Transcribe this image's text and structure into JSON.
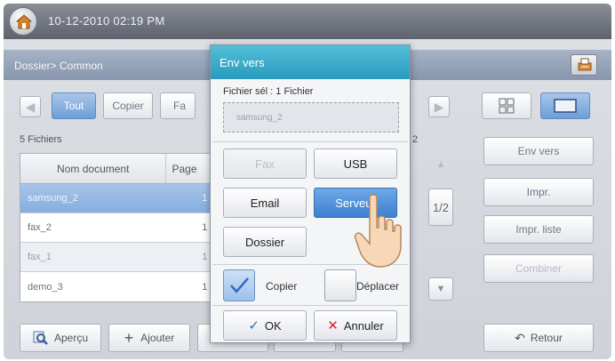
{
  "status_bar": {
    "datetime": "10-12-2010 02:19 PM"
  },
  "breadcrumb": {
    "path": "Dossier> Common"
  },
  "file_tabs": [
    {
      "label": "Tout",
      "state": "selected"
    },
    {
      "label": "Copier",
      "state": "normal"
    },
    {
      "label": "Fa",
      "state": "normal"
    }
  ],
  "file_list": {
    "count_label": "5 Fichiers",
    "page_indicator": "1/2",
    "columns": [
      "Nom document",
      "Page"
    ],
    "rows": [
      {
        "name": "samsung_2",
        "pages": "1",
        "state": "selected"
      },
      {
        "name": "fax_2",
        "pages": "1",
        "state": "normal"
      },
      {
        "name": "fax_1",
        "pages": "1",
        "state": "alt"
      },
      {
        "name": "demo_3",
        "pages": "1",
        "state": "normal"
      }
    ],
    "page_marker": "2"
  },
  "bottom_bar": {
    "preview_label": "Aperçu",
    "add_label": "Ajouter"
  },
  "right_panel": {
    "send_label": "Env vers",
    "print_label": "Impr.",
    "print_list_label": "Impr. liste",
    "combine_label": "Combiner",
    "back_label": "Retour"
  },
  "dialog": {
    "title": "Env vers",
    "selection_label": "Fichier sél : 1 Fichier",
    "selected_file": "samsung_2",
    "destinations": {
      "fax": "Fax",
      "usb": "USB",
      "email": "Email",
      "server": "Serveur",
      "folder": "Dossier"
    },
    "copy_label": "Copier",
    "move_label": "Déplacer",
    "ok_label": "OK",
    "cancel_label": "Annuler"
  },
  "colors": {
    "accent_title": "#2a9bbd",
    "selected_blue": "#6d9ed6",
    "cancel_x": "#e0262b"
  }
}
